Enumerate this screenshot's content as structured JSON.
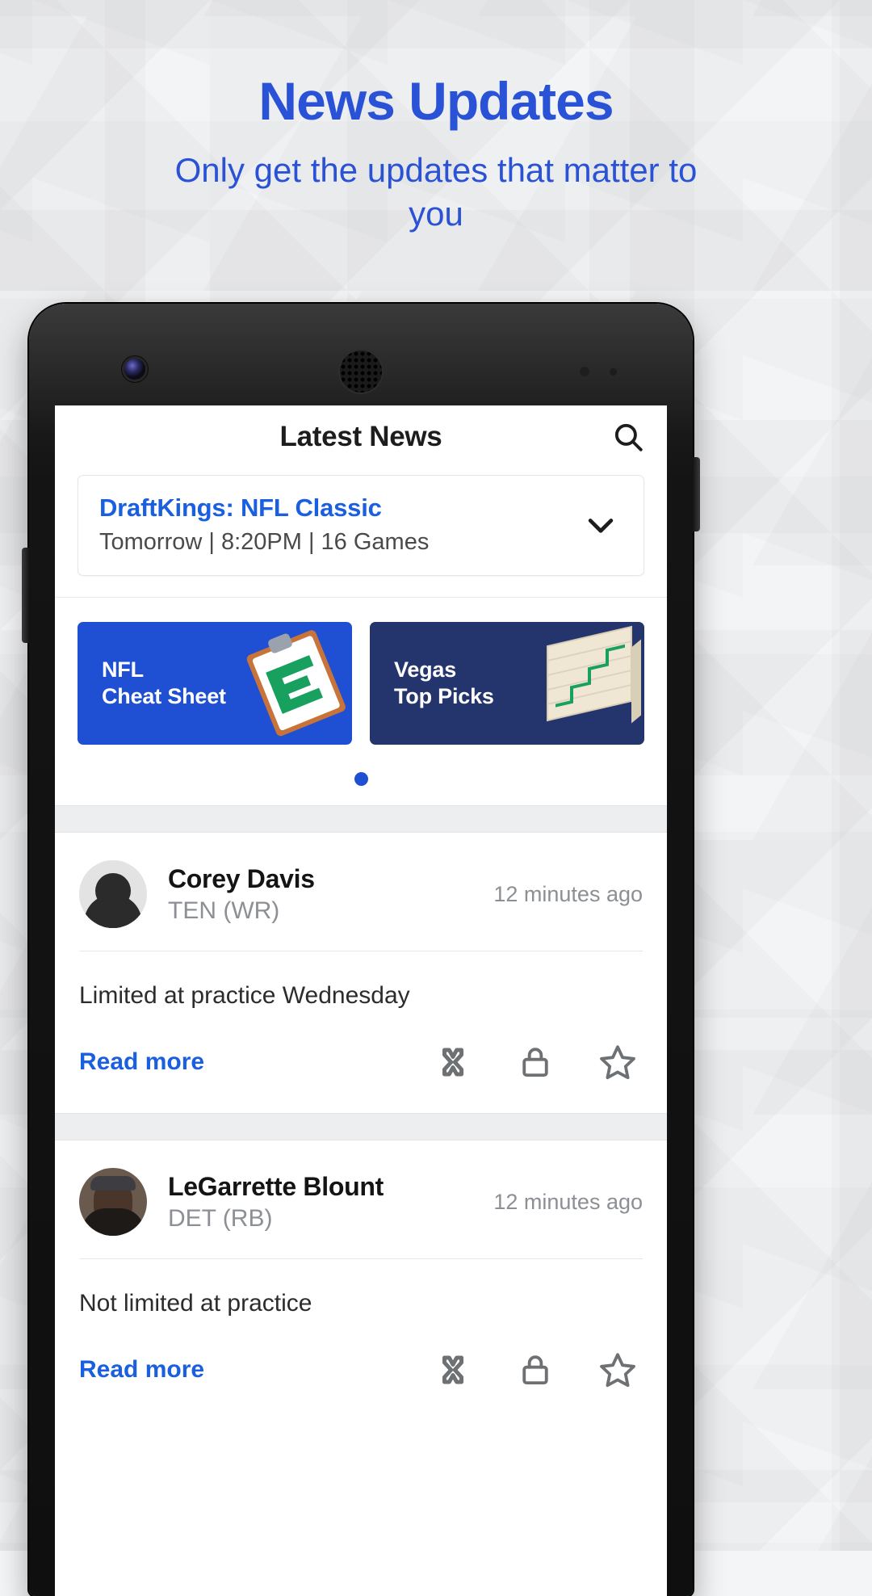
{
  "promo_header": {
    "headline": "News Updates",
    "subhead": "Only get the updates that matter to you",
    "headline_color": "#2a52d6"
  },
  "app": {
    "title": "Latest News",
    "search_icon": "search-icon"
  },
  "contest": {
    "title": "DraftKings: NFL Classic",
    "subtitle": "Tomorrow | 8:20PM | 16 Games",
    "expand_icon": "chevron-down-icon",
    "title_color": "#1a5fe0"
  },
  "promos": [
    {
      "line1": "NFL",
      "line2": "Cheat Sheet",
      "bg": "#1f50d3",
      "art": "clipboard-icon"
    },
    {
      "line1": "Vegas",
      "line2": "Top Picks",
      "bg": "#24356e",
      "art": "chart-board-icon"
    }
  ],
  "carousel": {
    "dots": 1,
    "active_index": 0,
    "dot_color": "#1f50d3"
  },
  "news_items": [
    {
      "player": "Corey Davis",
      "team": "TEN (WR)",
      "time": "12 minutes ago",
      "body": "Limited at practice Wednesday",
      "read_more": "Read more",
      "avatar_kind": "silhouette",
      "actions": [
        "mute-icon",
        "lock-icon",
        "star-icon"
      ]
    },
    {
      "player": "LeGarrette Blount",
      "team": "DET (RB)",
      "time": "12 minutes ago",
      "body": "Not limited at practice",
      "read_more": "Read more",
      "avatar_kind": "photo",
      "actions": [
        "mute-icon",
        "lock-icon",
        "star-icon"
      ]
    }
  ]
}
